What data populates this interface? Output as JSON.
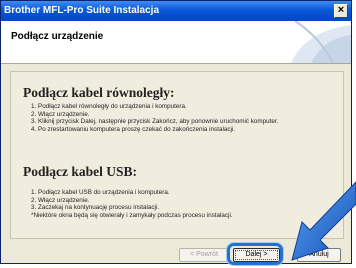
{
  "window": {
    "title": "Brother MFL-Pro Suite Instalacja",
    "close_glyph": "×"
  },
  "header": {
    "title": "Podłącz urządzenie",
    "art_icon": "setup-graphic-icon"
  },
  "parallel": {
    "heading": "Podłącz kabel równoległy:",
    "steps": [
      "1. Podłącz kabel równoległy do urządzenia i komputera.",
      "2. Włącz urządzenie.",
      "3. Kliknij przycisk Dalej, następnie przycisk Zakończ, aby ponownie uruchomić komputer.",
      "4. Po zrestartowaniu komputera proszę czekać do zakończenia instalacji."
    ]
  },
  "usb": {
    "heading": "Podłącz kabel USB:",
    "steps": [
      "1. Podłącz kabel USB do urządzenia i komputera.",
      "2. Włącz urządzenie.",
      "3. Zaczekaj na kontynuację procesu instalacji.",
      "*Niektóre okna będą się otwierały i zamykały podczas procesu instalacji."
    ]
  },
  "buttons": {
    "back": "< Powrót",
    "next": "Dalej >",
    "cancel": "Anuluj"
  },
  "colors": {
    "highlight": "#1f73d6",
    "titlebar": "#0a58d8"
  }
}
